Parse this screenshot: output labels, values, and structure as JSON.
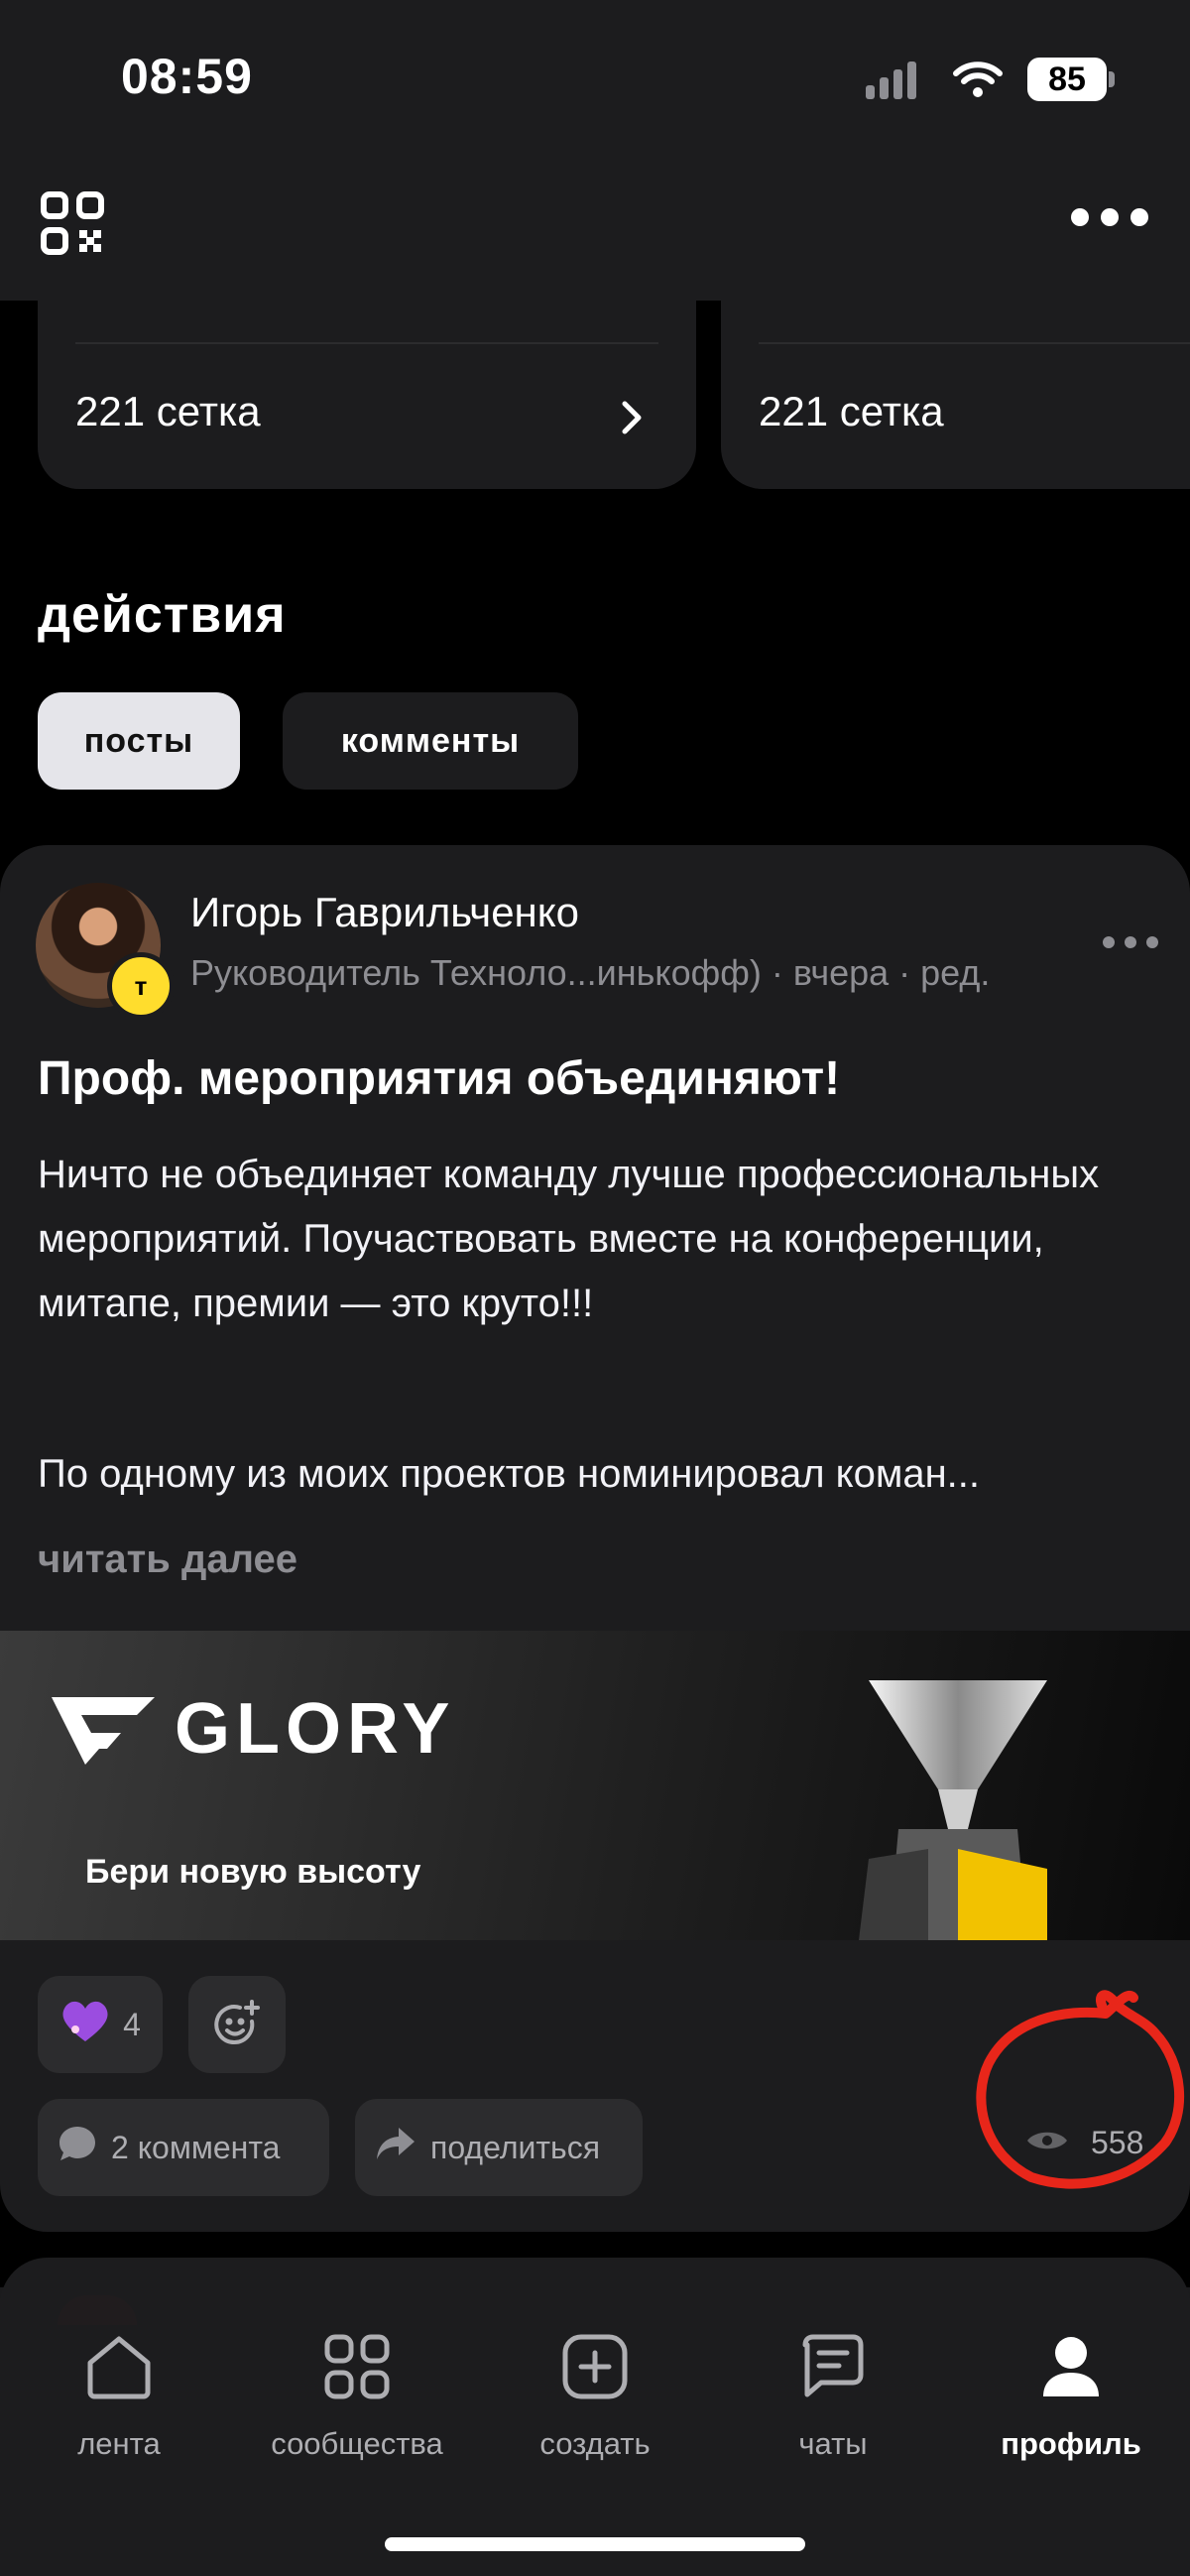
{
  "status_bar": {
    "time": "08:59",
    "battery": "85"
  },
  "cards": [
    {
      "label": "221 сетка"
    },
    {
      "label": "221 сетка"
    }
  ],
  "actions": {
    "title": "действия",
    "tabs": [
      {
        "label": "посты",
        "active": true
      },
      {
        "label": "комменты",
        "active": false
      }
    ]
  },
  "post": {
    "author": "Игорь Гаврильченко",
    "badge": "т",
    "subtitle": "Руководитель Техноло...инькофф) · вчера · ред.",
    "title": "Проф. мероприятия объединяют!",
    "body": "Ничто не объединяет команду лучше профессиональных мероприятий. Поучаствовать вместе на конференции, митапе, премии — это круто!!!",
    "body2": "По одному из моих проектов номинировал коман...",
    "read_more": "читать далее",
    "banner": {
      "logo": "GLORY",
      "tagline": "Бери новую высоту"
    },
    "reaction_count": "4",
    "comments": "2 коммента",
    "share": "поделиться",
    "views": "558"
  },
  "tabbar": [
    {
      "label": "лента",
      "icon": "home-icon"
    },
    {
      "label": "сообщества",
      "icon": "grid-icon"
    },
    {
      "label": "создать",
      "icon": "plus-square-icon"
    },
    {
      "label": "чаты",
      "icon": "chat-icon"
    },
    {
      "label": "профиль",
      "icon": "profile-icon",
      "active": true
    }
  ],
  "colors": {
    "background": "#000000",
    "surface": "#1c1c1e",
    "chip": "#2c2c2e",
    "annotation": "#e8261a",
    "badge": "#ffdd2d"
  }
}
